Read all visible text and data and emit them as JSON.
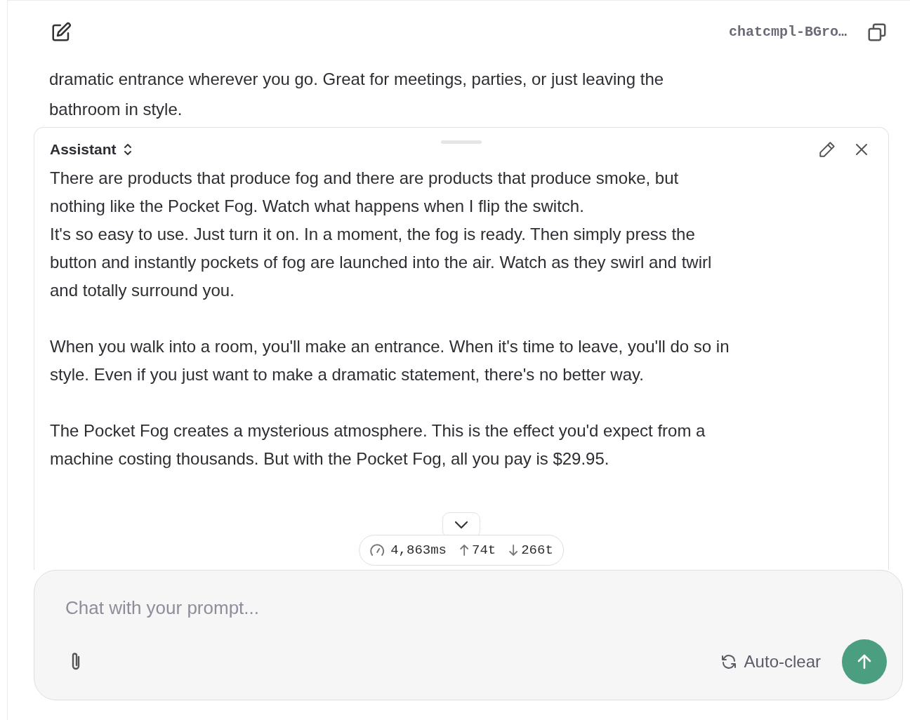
{
  "header": {
    "completion_id": "chatcmpl-BGro…"
  },
  "user_message": {
    "lines": [
      "dramatic entrance wherever you go. Great for meetings, parties, or just leaving the",
      "bathroom in style."
    ]
  },
  "assistant_message": {
    "role_label": "Assistant",
    "paragraphs": [
      [
        "There are products that produce fog and there are products that produce smoke, but",
        "nothing like the Pocket Fog. Watch what happens when I flip the switch.",
        "It's so easy to use. Just turn it on. In a moment, the fog is ready. Then simply press the",
        "button and instantly pockets of fog are launched into the air. Watch as they swirl and twirl",
        "and totally surround you."
      ],
      [
        "When you walk into a room, you'll make an entrance. When it's time to leave, you'll do so in",
        "style. Even if you just want to make a dramatic statement, there's no better way."
      ],
      [
        "The Pocket Fog creates a mysterious atmosphere. This is the effect you'd expect from a",
        "machine costing thousands. But with the Pocket Fog, all you pay is $29.95."
      ]
    ]
  },
  "metrics": {
    "latency": "4,863ms",
    "tokens_in": "74t",
    "tokens_out": "266t"
  },
  "composer": {
    "placeholder": "Chat with your prompt...",
    "auto_clear_label": "Auto-clear"
  }
}
